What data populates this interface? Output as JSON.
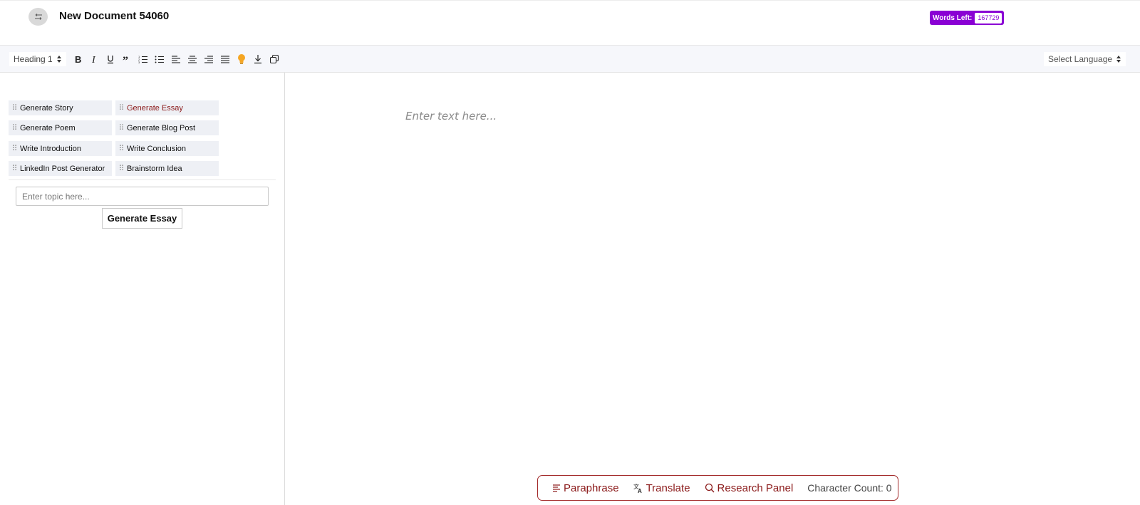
{
  "header": {
    "back_icon": "return-arrow-icon",
    "title": "New Document 54060",
    "words_left_label": "Words Left:",
    "words_left_count": "167729"
  },
  "toolbar": {
    "heading_select": "Heading 1",
    "icons": [
      "bold-icon",
      "italic-icon",
      "underline-icon",
      "quote-icon",
      "ordered-list-icon",
      "bullet-list-icon",
      "align-left-icon",
      "align-center-icon",
      "align-right-icon",
      "align-justify-icon",
      "lightbulb-icon",
      "download-icon",
      "copy-icon"
    ],
    "language_select": "Select Language"
  },
  "tools": {
    "items": [
      {
        "label": "Generate Story"
      },
      {
        "label": "Generate Essay",
        "active": true
      },
      {
        "label": "Generate Poem"
      },
      {
        "label": "Generate Blog Post"
      },
      {
        "label": "Write Introduction"
      },
      {
        "label": "Write Conclusion"
      },
      {
        "label": "LinkedIn Post Generator"
      },
      {
        "label": "Brainstorm Idea"
      }
    ],
    "topic_placeholder": "Enter topic here...",
    "generate_button": "Generate Essay"
  },
  "editor": {
    "placeholder": "Enter text here..."
  },
  "bottom_bar": {
    "paraphrase": "Paraphrase",
    "translate": "Translate",
    "research_panel": "Research Panel",
    "character_count": "Character Count: 0"
  },
  "colors": {
    "accent_purple": "#8a00d4",
    "accent_red": "#8b1a1a",
    "lightbulb": "#f5a623"
  }
}
